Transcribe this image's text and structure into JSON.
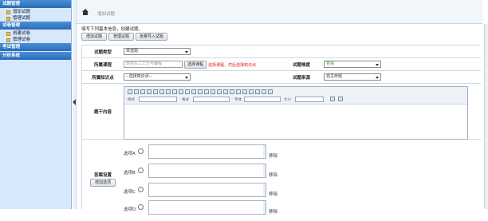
{
  "sidebar": {
    "sections": [
      {
        "title": "试题管理",
        "items": [
          "增加试题",
          "管理试题"
        ]
      },
      {
        "title": "试卷管理",
        "items": [
          "创建试卷",
          "管理试卷"
        ]
      },
      {
        "title": "考试管理",
        "items": []
      },
      {
        "title": "分析系统",
        "items": []
      }
    ]
  },
  "breadcrumb": "增加试题",
  "intro": "填写下列基本信息，创建试题。",
  "buttons": {
    "add": "增加试题",
    "manage": "管理试题",
    "batch": "批量导入试题"
  },
  "form": {
    "type_label": "试题类型",
    "type_value": "单选题",
    "course_label": "所属课程",
    "course_placeholder": "数控车工工艺与编程",
    "course_button": "选择课程",
    "course_hint": "选择课程，然后选择知识点",
    "difficulty_label": "试题难度",
    "difficulty_value": "容易",
    "knowledge_label": "所属知识点",
    "knowledge_value": "--选择知识点--",
    "source_label": "试题来源",
    "source_value": "自主命题",
    "content_label": "题干内容",
    "answer_label": "答案设置",
    "add_option_button": "增加选项",
    "options": [
      {
        "label": "选项A",
        "remove": "移除"
      },
      {
        "label": "选项B",
        "remove": "移除"
      },
      {
        "label": "选项C",
        "remove": "移除"
      },
      {
        "label": "选项D",
        "remove": "移除"
      }
    ]
  },
  "editor": {
    "style_label": "样式",
    "format_label": "格式",
    "font_label": "字体",
    "size_label": "大小"
  },
  "colors": {
    "sidebar_header": "#2a6bb8",
    "sidebar_bg": "#d7e8fa",
    "hint": "#e21a1a",
    "difficulty": "#2aa52a"
  }
}
